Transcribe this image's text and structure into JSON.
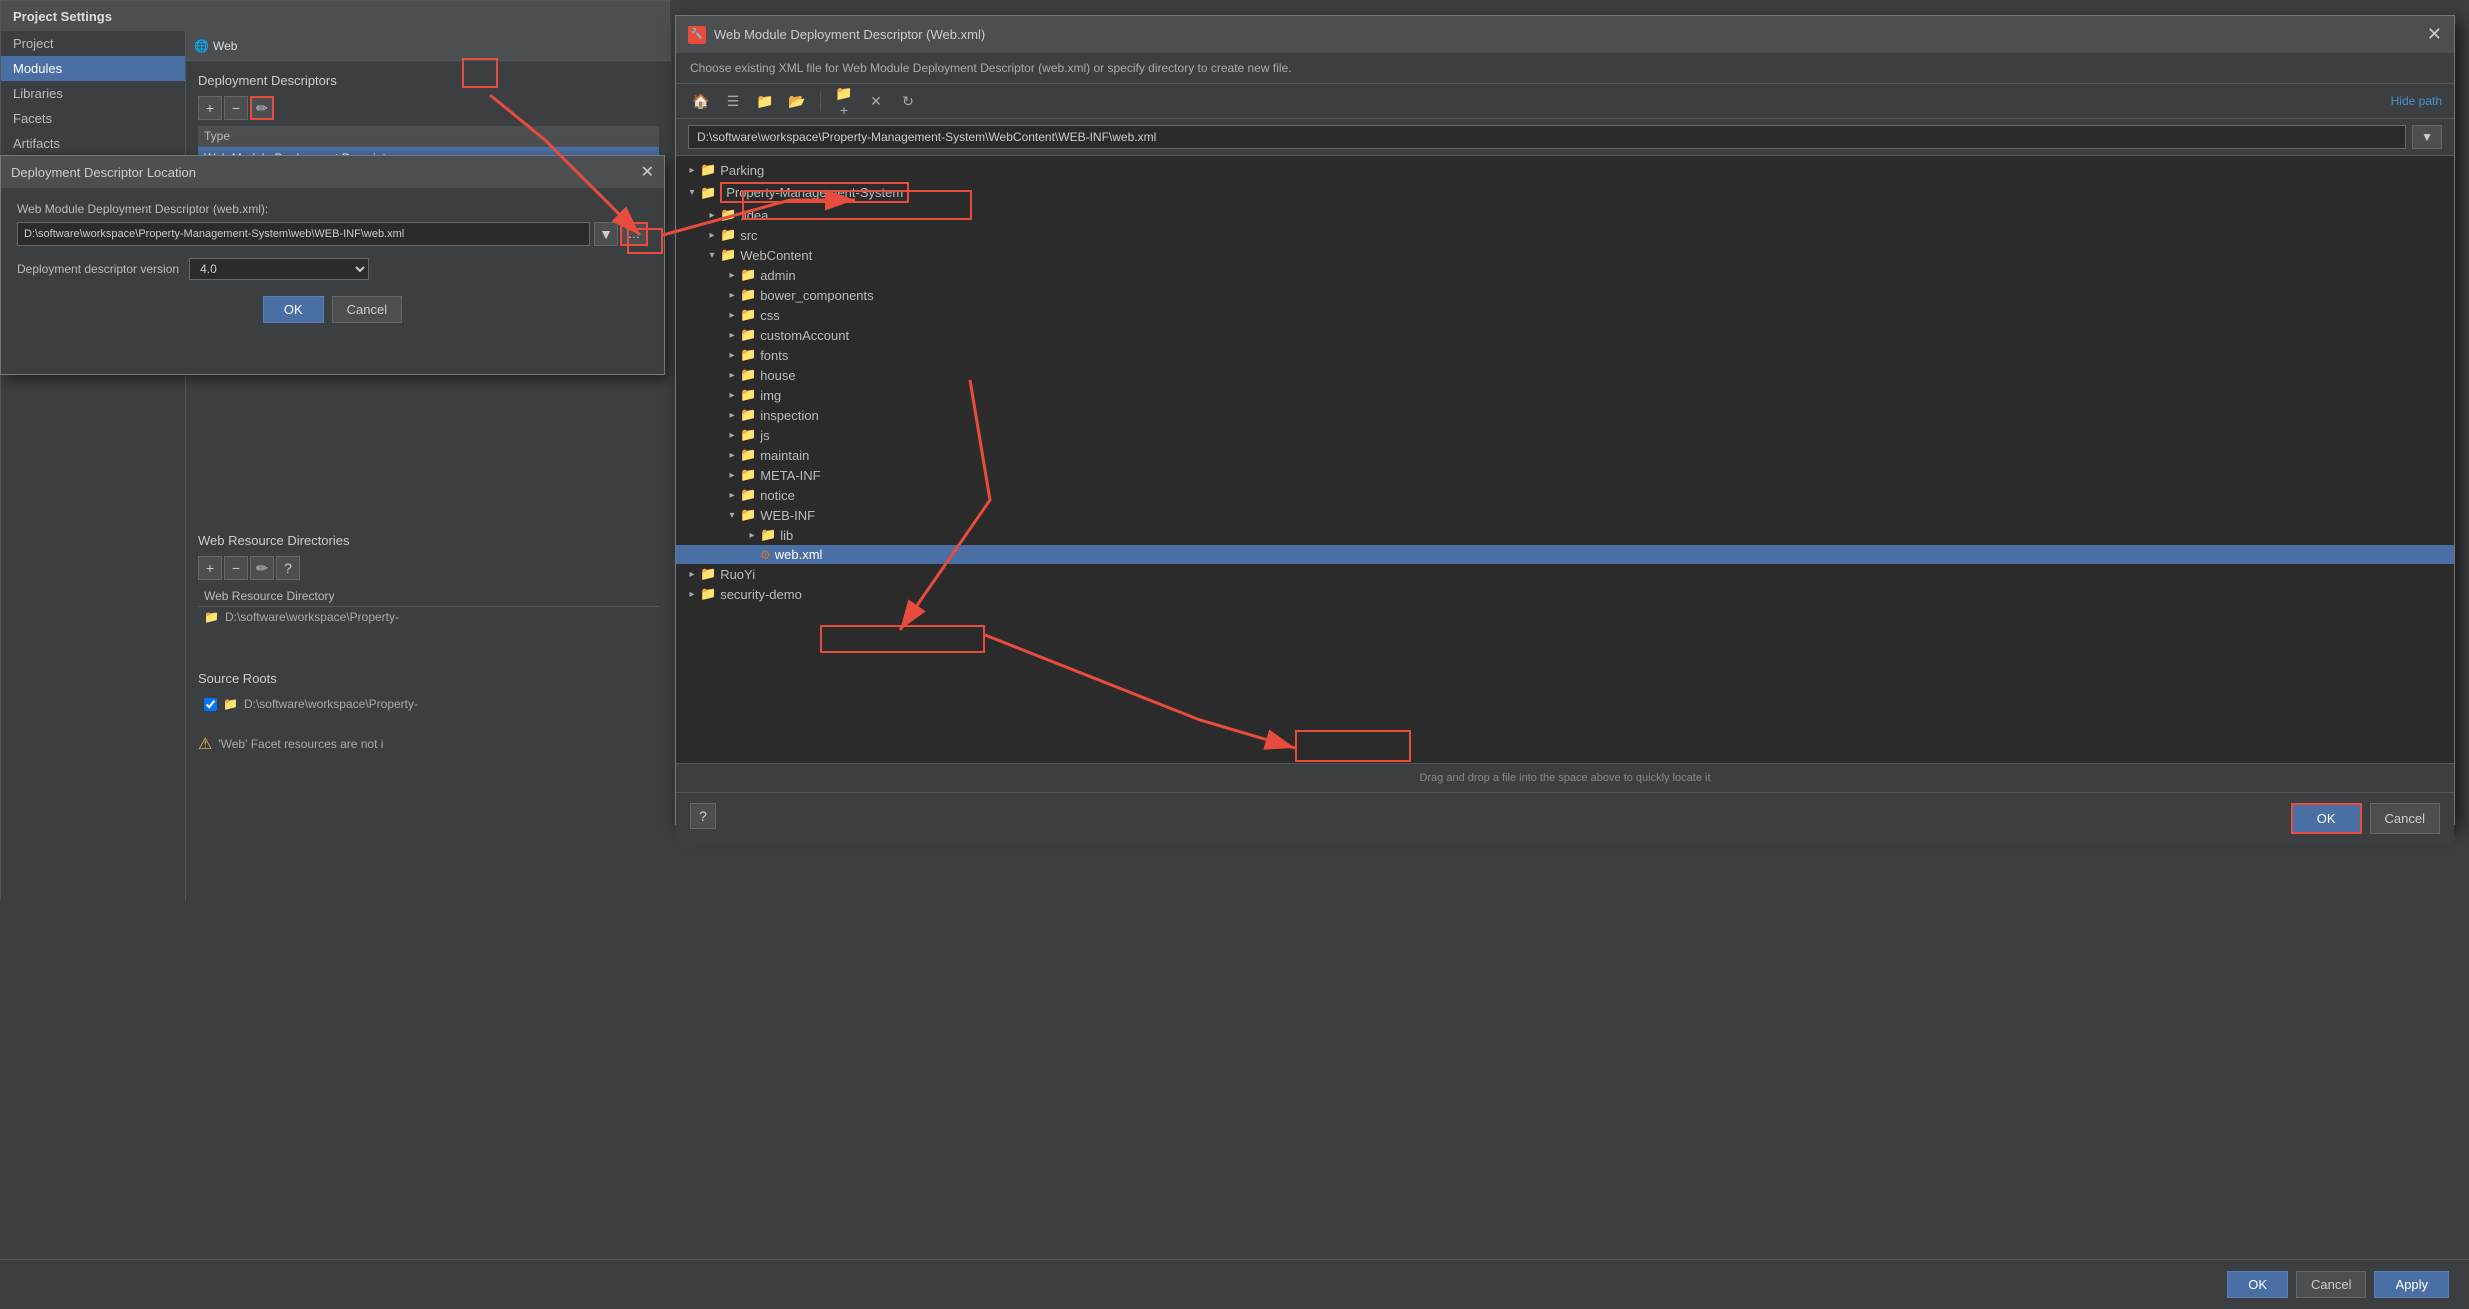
{
  "projectSettings": {
    "title": "Project Settings",
    "menuItems": [
      {
        "label": "Project",
        "active": false
      },
      {
        "label": "Modules",
        "active": true
      },
      {
        "label": "Libraries",
        "active": false
      },
      {
        "label": "Facets",
        "active": false
      },
      {
        "label": "Artifacts",
        "active": false
      }
    ],
    "moduleLabel": "Web"
  },
  "deploymentDescriptors": {
    "title": "Deployment Descriptors",
    "typeHeader": "Type",
    "ddItem": "Web Module Deployment Descriptor"
  },
  "ddlDialog": {
    "title": "Deployment Descriptor Location",
    "label": "Web Module Deployment Descriptor (web.xml):",
    "inputValue": "D:\\software\\workspace\\Property-Management-System\\web\\WEB-INF\\web.xml",
    "versionLabel": "Deployment descriptor version",
    "versionValue": "4.0",
    "okLabel": "OK",
    "cancelLabel": "Cancel"
  },
  "webResourceDirectories": {
    "title": "Web Resource Directories",
    "dirValue": "D:\\software\\workspace\\Property-"
  },
  "sourceRoots": {
    "title": "Source Roots",
    "rootValue": "D:\\software\\workspace\\Property-"
  },
  "warningText": "'Web' Facet resources are not i",
  "wmmDialog": {
    "title": "Web Module Deployment Descriptor (Web.xml)",
    "subtitle": "Choose existing XML file for Web Module Deployment Descriptor (web.xml) or specify directory to create new file.",
    "hidePathLabel": "Hide path",
    "pathValue": "D:\\software\\workspace\\Property-Management-System\\WebContent\\WEB-INF\\web.xml",
    "dragDropText": "Drag and drop a file into the space above to quickly locate it",
    "okLabel": "OK",
    "cancelLabel": "Cancel",
    "treeItems": [
      {
        "name": "Parking",
        "type": "folder",
        "depth": 0,
        "expanded": false
      },
      {
        "name": "Property-Management-System",
        "type": "folder",
        "depth": 0,
        "expanded": true,
        "highlighted": true
      },
      {
        "name": ".idea",
        "type": "folder",
        "depth": 1,
        "expanded": false
      },
      {
        "name": "src",
        "type": "folder",
        "depth": 1,
        "expanded": false
      },
      {
        "name": "WebContent",
        "type": "folder",
        "depth": 1,
        "expanded": true
      },
      {
        "name": "admin",
        "type": "folder",
        "depth": 2,
        "expanded": false
      },
      {
        "name": "bower_components",
        "type": "folder",
        "depth": 2,
        "expanded": false
      },
      {
        "name": "css",
        "type": "folder",
        "depth": 2,
        "expanded": false
      },
      {
        "name": "customAccount",
        "type": "folder",
        "depth": 2,
        "expanded": false
      },
      {
        "name": "fonts",
        "type": "folder",
        "depth": 2,
        "expanded": false
      },
      {
        "name": "house",
        "type": "folder",
        "depth": 2,
        "expanded": false
      },
      {
        "name": "img",
        "type": "folder",
        "depth": 2,
        "expanded": false
      },
      {
        "name": "inspection",
        "type": "folder",
        "depth": 2,
        "expanded": false
      },
      {
        "name": "js",
        "type": "folder",
        "depth": 2,
        "expanded": false
      },
      {
        "name": "maintain",
        "type": "folder",
        "depth": 2,
        "expanded": false
      },
      {
        "name": "META-INF",
        "type": "folder",
        "depth": 2,
        "expanded": false
      },
      {
        "name": "notice",
        "type": "folder",
        "depth": 2,
        "expanded": false
      },
      {
        "name": "WEB-INF",
        "type": "folder",
        "depth": 2,
        "expanded": true
      },
      {
        "name": "lib",
        "type": "folder",
        "depth": 3,
        "expanded": false
      },
      {
        "name": "web.xml",
        "type": "xml",
        "depth": 3,
        "selected": true
      },
      {
        "name": "RuoYi",
        "type": "folder",
        "depth": 0,
        "expanded": false
      },
      {
        "name": "security-demo",
        "type": "folder",
        "depth": 0,
        "expanded": false
      }
    ]
  },
  "bottomBar": {
    "okLabel": "OK",
    "cancelLabel": "Cancel",
    "applyLabel": "Apply"
  }
}
